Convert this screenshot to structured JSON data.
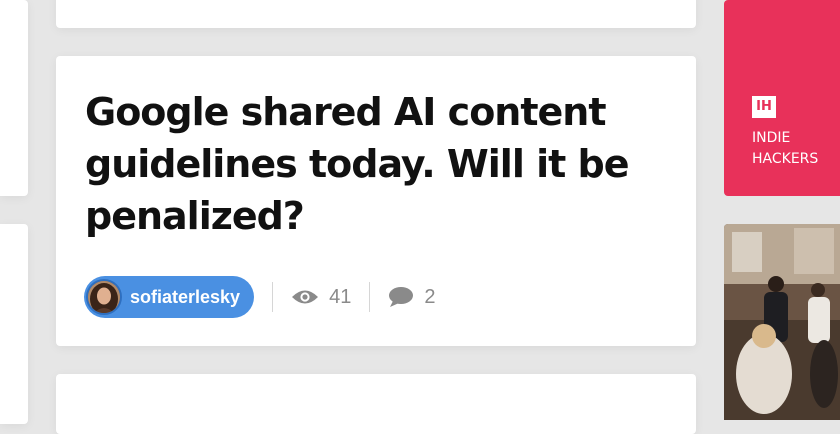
{
  "post": {
    "title": "Google shared AI content guidelines today. Will it be penalized?",
    "author": "sofiaterlesky",
    "views": "41",
    "comments": "2"
  },
  "icons": {
    "views": "eye-icon",
    "comments": "speech-bubble-icon"
  },
  "sidebar": {
    "ih_logo_text": "IH",
    "ih_line1": "INDIE",
    "ih_line2": "HACKERS"
  },
  "colors": {
    "author_pill": "#4a90e2",
    "ih_brand": "#e8315a",
    "meta_gray": "#8a8a8a"
  }
}
